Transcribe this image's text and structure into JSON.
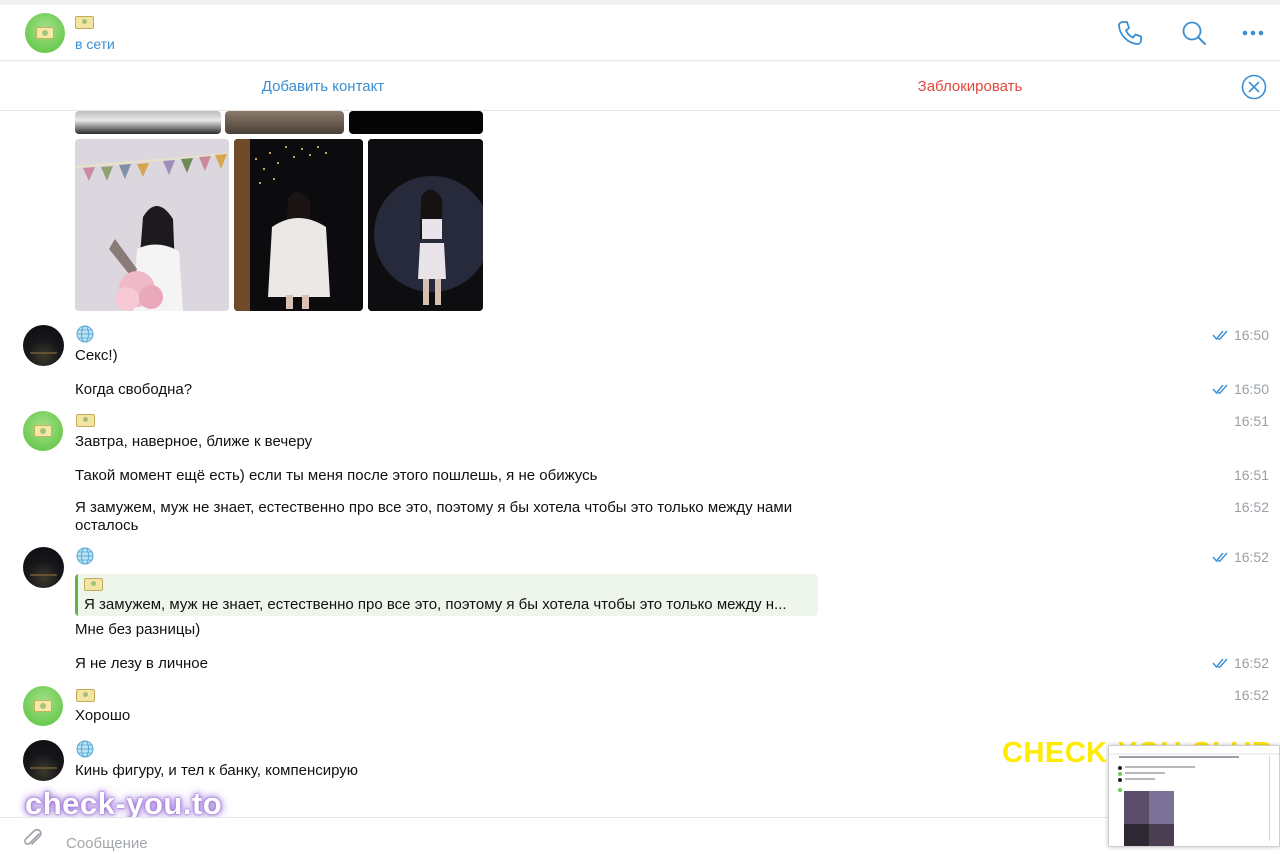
{
  "header": {
    "status": "в сети",
    "icons": [
      "phone-icon",
      "search-icon",
      "more-icon"
    ]
  },
  "action_bar": {
    "add_contact": "Добавить контакт",
    "block": "Заблокировать",
    "close_icon": "close-circle-icon"
  },
  "messages": [
    {
      "sender": "globe",
      "text": "Секс!)",
      "time": "16:50",
      "read": true
    },
    {
      "sender": "globe",
      "text": "Когда свободна?",
      "time": "16:50",
      "read": true
    },
    {
      "sender": "money",
      "text": "Завтра, наверное, ближе к вечеру",
      "time": "16:51",
      "read": false
    },
    {
      "sender": "money",
      "text": "Такой момент ещё есть) если ты меня после этого пошлешь, я не обижусь",
      "time": "16:51",
      "read": false
    },
    {
      "sender": "money",
      "text": "Я замужем, муж не знает, естественно про все это, поэтому я бы хотела чтобы это только между нами осталось",
      "time": "16:52",
      "read": false
    },
    {
      "sender": "globe",
      "text": "Мне без разницы)",
      "time": "16:52",
      "read": true,
      "reply_to": "Я замужем, муж не знает, естественно про все это, поэтому я бы хотела чтобы это только между н..."
    },
    {
      "sender": "globe",
      "text": "Я не лезу в личное",
      "time": "16:52",
      "read": true
    },
    {
      "sender": "money",
      "text": "Хорошо",
      "time": "16:52",
      "read": false
    },
    {
      "sender": "globe",
      "text": "Кинь фигуру, и тел к банку, компенсирую",
      "time": "",
      "read": false
    }
  ],
  "composer": {
    "placeholder": "Сообщение",
    "attach_icon": "paperclip-icon"
  },
  "watermarks": {
    "left": "check-you.to",
    "right": "CHECK-YOU.CLUB"
  },
  "colors": {
    "accent": "#3a8fd3",
    "danger": "#e1483d",
    "reply_bg": "#eef6ec",
    "reply_bar": "#5fb548",
    "time": "#9aa0a6"
  }
}
